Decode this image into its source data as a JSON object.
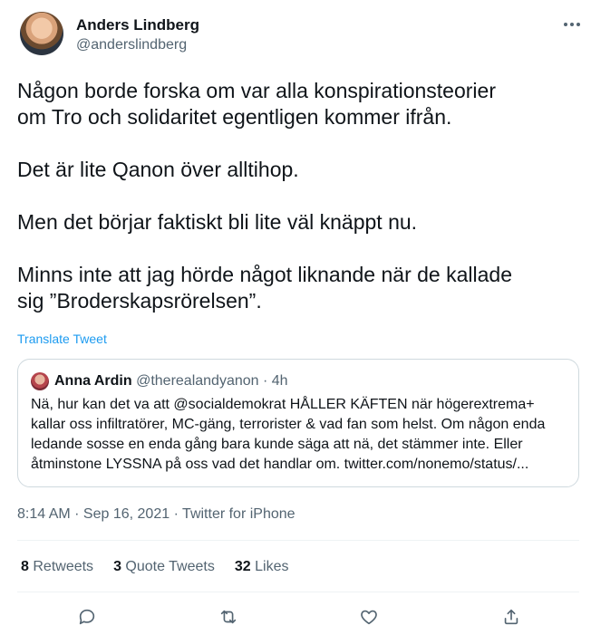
{
  "author": {
    "name": "Anders Lindberg",
    "handle": "@anderslindberg"
  },
  "tweet": {
    "text": "Någon borde forska om var alla konspirationsteorier\nom Tro och solidaritet egentligen kommer ifrån.\n\nDet är lite Qanon över alltihop.\n\nMen det börjar faktiskt bli lite väl knäppt nu.\n\nMinns inte att jag hörde något liknande när de kallade\nsig ”Broderskapsrörelsen”.",
    "translate_label": "Translate Tweet"
  },
  "quote": {
    "name": "Anna Ardin",
    "handle": "@therealandyanon",
    "separator": "·",
    "time": "4h",
    "text": "Nä, hur kan det va att @socialdemokrat HÅLLER KÄFTEN när högerextrema+ kallar oss infiltratörer, MC-gäng, terrorister & vad fan som helst. Om någon enda ledande sosse en enda gång bara kunde säga att nä, det stämmer inte. Eller åtminstone LYSSNA på oss vad det handlar om. twitter.com/nonemo/status/..."
  },
  "meta": {
    "text": "8:14 AM · Sep 16, 2021 · Twitter for iPhone"
  },
  "stats": {
    "retweets_count": "8",
    "retweets_label": "Retweets",
    "quotes_count": "3",
    "quotes_label": "Quote Tweets",
    "likes_count": "32",
    "likes_label": "Likes"
  },
  "icons": {
    "more": "more-horizontal-icon",
    "reply": "reply-icon",
    "retweet": "retweet-icon",
    "like": "like-icon",
    "share": "share-icon"
  },
  "colors": {
    "link": "#1d9bf0",
    "secondary_text": "#536471",
    "border": "#cfd9de"
  }
}
